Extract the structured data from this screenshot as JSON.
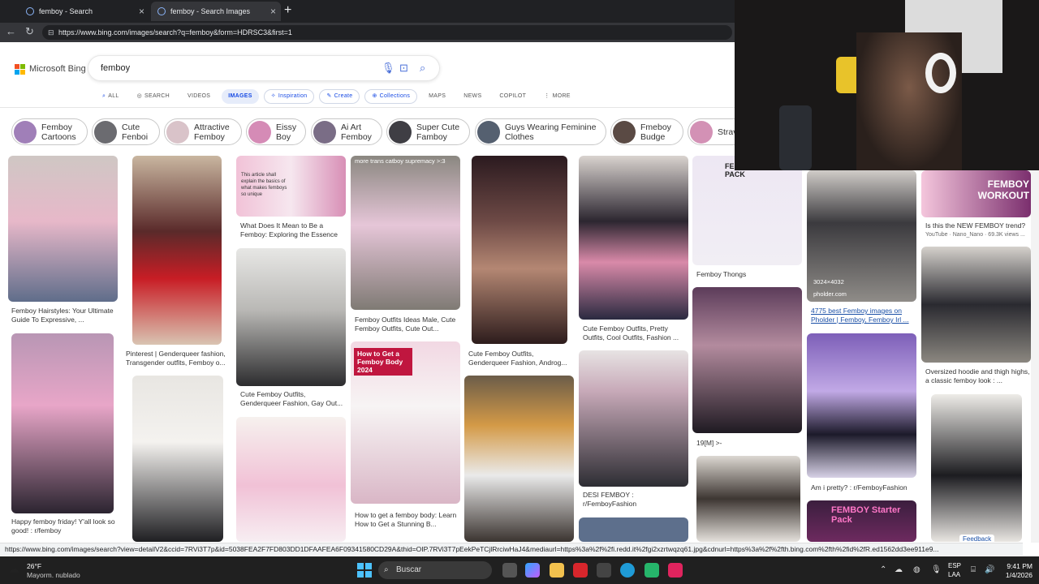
{
  "browser": {
    "tabs": [
      {
        "label": "femboy - Search",
        "active": false
      },
      {
        "label": "femboy - Search Images",
        "active": true
      }
    ],
    "new_tab": "+",
    "url": "https://www.bing.com/images/search?q=femboy&form=HDRSC3&first=1",
    "status_url": "https://www.bing.com/images/search?view=detailV2&ccid=7RVi3T7p&id=5038FEA2F7FD803DD1DFAAFEA6F09341580CD29A&thid=OIP.7RVi3T7pEekPeTCjlRrciwHaJ4&mediaurl=https%3a%2f%2fi.redd.it%2fgi2xzrtwqzq61.jpg&cdnurl=https%3a%2f%2fth.bing.com%2fth%2fid%2fR.ed1562dd3ee911e9..."
  },
  "bing": {
    "logo": "Microsoft Bing",
    "query": "femboy",
    "scopes": [
      "ALL",
      "SEARCH",
      "VIDEOS",
      "IMAGES",
      "Inspiration",
      "Create",
      "Collections",
      "MAPS",
      "NEWS",
      "COPILOT",
      "MORE"
    ],
    "selected_scope": "IMAGES",
    "chips": [
      "Femboy Cartoons",
      "Cute Fenboi",
      "Attractive Femboy",
      "Eissy Boy",
      "Ai Art Femboy",
      "Super Cute Famboy",
      "Guys Wearing Feminine Clothes",
      "Fmeboy Budge",
      "Strav"
    ]
  },
  "results": {
    "c1": [
      "Femboy Hairstyles: Your Ultimate Guide To Expressive, ...",
      "Happy femboy friday! Y'all look so good! : r/femboy"
    ],
    "c2": [
      "Pinterest | Genderqueer fashion, Transgender outfits, Femboy o..."
    ],
    "c3": [
      "What Does It Mean to Be a Femboy: Exploring the Essence",
      "Cute Femboy Outfits, Genderqueer Fashion, Gay Out..."
    ],
    "c4": [
      "Femboy Outfits Ideas Male, Cute Femboy Outfits, Cute Out...",
      "How to get a femboy body: Learn How to Get a Stunning B..."
    ],
    "c5": [
      "Cute Femboy Outfits, Genderqueer Fashion, Androg..."
    ],
    "c6": [
      "Cute Femboy Outfits, Pretty Outfits, Cool Outfits, Fashion ...",
      "DESI FEMBOY : r/FemboyFashion"
    ],
    "c7": [
      "Femboy Thongs",
      "19[M] >-"
    ],
    "c8": [
      "4775 best Femboy images on Pholder | Femboy, Femboy Irl ...",
      "Am i pretty? : r/FemboyFashion"
    ],
    "c9": [
      "Is this the NEW FEMBOY trend?",
      "YouTube · Nano_Nano · 69.3K views ...",
      "Oversized hoodie and thigh highs, a classic femboy look : ..."
    ],
    "overlay_texts": {
      "img_dims": "3024×4032",
      "img_source": "pholder.com",
      "starter_pack": "FEMBOY STARTER PACK",
      "workout": "FEMBOY WORKOUT",
      "body_2024": "How to Get a Femboy Body 2024",
      "essence_img_text": "This article shall explain the basics of what makes femboys so unique",
      "more_trans": "more trans catboy supremacy >:3",
      "femboy_starter": "FEMBOY Starter Pack",
      "feedback": "Feedback"
    }
  },
  "taskbar": {
    "temp": "26°F",
    "weather": "Mayorm. nublado",
    "search": "Buscar",
    "lang": "ESP",
    "lang2": "LAA",
    "time": "9:41 PM",
    "date": "1/4/2026"
  }
}
